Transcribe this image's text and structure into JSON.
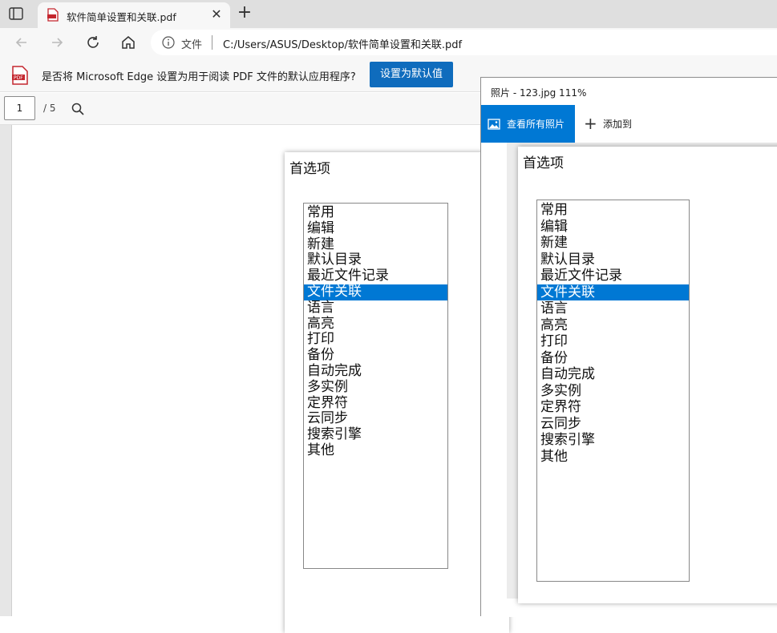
{
  "browser": {
    "tab_title": "软件简单设置和关联.pdf",
    "tab_close": "✕",
    "new_tab": "+",
    "address_scheme": "文件",
    "address_url": "C:/Users/ASUS/Desktop/软件简单设置和关联.pdf"
  },
  "infobar": {
    "message": "是否将 Microsoft Edge 设置为用于阅读 PDF 文件的默认应用程序?",
    "button": "设置为默认值"
  },
  "pdf_toolbar": {
    "page_number": "1",
    "total_pages": "/ 5"
  },
  "dialog": {
    "title": "首选项",
    "items": [
      "常用",
      "编辑",
      "新建",
      "默认目录",
      "最近文件记录",
      "文件关联",
      "语言",
      "高亮",
      "打印",
      "备份",
      "自动完成",
      "多实例",
      "定界符",
      "云同步",
      "搜索引擎",
      "其他"
    ],
    "selected": "文件关联"
  },
  "photos": {
    "title": "照片 - 123.jpg   111%",
    "view_all": "查看所有照片",
    "add_to": "添加到"
  },
  "colors": {
    "accent": "#0078d4",
    "edge_button": "#0f6cbd"
  }
}
